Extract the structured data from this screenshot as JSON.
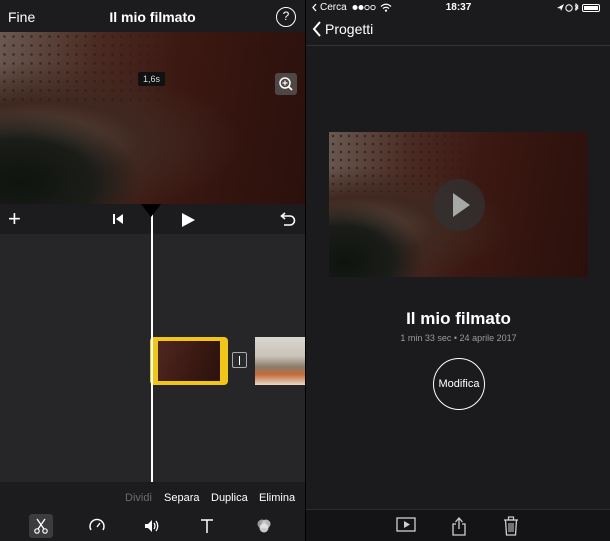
{
  "editor": {
    "done_label": "Fine",
    "title": "Il mio filmato",
    "help_label": "?",
    "timecode": "1,6s",
    "actions": {
      "split": "Dividi",
      "detach": "Separa",
      "duplicate": "Duplica",
      "delete": "Elimina"
    },
    "tools": [
      "scissors-icon",
      "speedometer-icon",
      "volume-icon",
      "text-icon",
      "filters-icon"
    ],
    "accent_color": "#f2c519"
  },
  "status_bar": {
    "carrier": "Cerca",
    "time": "18:37"
  },
  "project": {
    "back_label": "Progetti",
    "title": "Il mio filmato",
    "meta": "1 min 33 sec • 24 aprile 2017",
    "edit_label": "Modifica"
  }
}
